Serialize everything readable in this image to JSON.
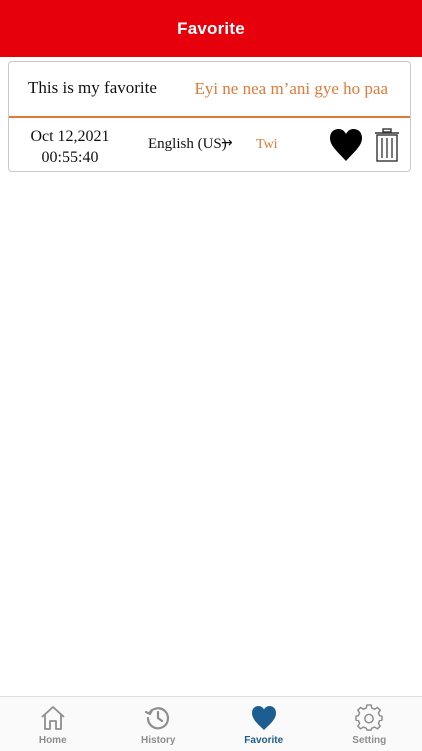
{
  "colors": {
    "header_bg": "#e5000c",
    "accent_orange": "#e07a3a",
    "tab_active": "#1d5d8f",
    "tab_inactive": "#8e8e8e"
  },
  "header": {
    "title": "Favorite"
  },
  "favorites": [
    {
      "source_text": "This is my favorite",
      "target_text": "Eyi ne nea m’ani gye ho paa",
      "date": "Oct 12,2021",
      "time": "00:55:40",
      "from_language": "English (US)",
      "arrow": "→",
      "to_language": "Twi",
      "favorite_icon": "heart-filled-icon",
      "delete_icon": "trash-icon"
    }
  ],
  "tabbar": {
    "active": "favorite",
    "items": [
      {
        "key": "home",
        "label": "Home",
        "icon": "home-icon"
      },
      {
        "key": "history",
        "label": "History",
        "icon": "history-icon"
      },
      {
        "key": "favorite",
        "label": "Favorite",
        "icon": "heart-icon"
      },
      {
        "key": "setting",
        "label": "Setting",
        "icon": "gear-icon"
      }
    ]
  }
}
